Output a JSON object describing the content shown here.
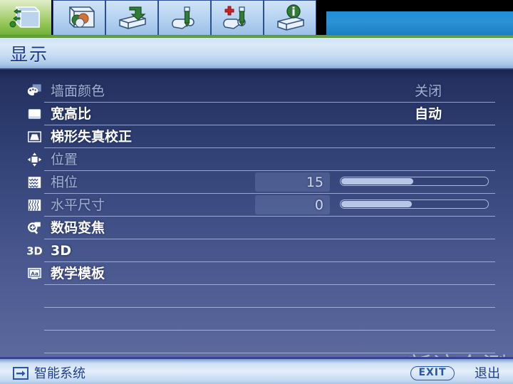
{
  "tabs": [
    {
      "name": "display",
      "icon": "display-screen-gear-icon",
      "active": true
    },
    {
      "name": "picture",
      "icon": "picture-color-icon",
      "active": false
    },
    {
      "name": "source",
      "icon": "projector-input-icon",
      "active": false
    },
    {
      "name": "system",
      "icon": "wrench-screwdriver-icon",
      "active": false
    },
    {
      "name": "advanced",
      "icon": "wrench-plus-icon",
      "active": false
    },
    {
      "name": "info",
      "icon": "projector-info-icon",
      "active": false
    }
  ],
  "title": "显示",
  "menu": {
    "rows": [
      {
        "icon": "palette-icon",
        "label": "墙面颜色",
        "value": "关闭",
        "enabled": false,
        "type": "value"
      },
      {
        "icon": "aspect-screen-icon",
        "label": "宽高比",
        "value": "自动",
        "enabled": true,
        "type": "value"
      },
      {
        "icon": "keystone-icon",
        "label": "梯形失真校正",
        "value": "",
        "enabled": true,
        "type": "submenu"
      },
      {
        "icon": "position-arrows-icon",
        "label": "位置",
        "value": "",
        "enabled": false,
        "type": "submenu"
      },
      {
        "icon": "phase-wave-icon",
        "label": "相位",
        "value": "15",
        "enabled": false,
        "type": "slider",
        "percent": 49
      },
      {
        "icon": "hsize-wave-icon",
        "label": "水平尺寸",
        "value": "0",
        "enabled": false,
        "type": "slider",
        "percent": 48
      },
      {
        "icon": "digital-zoom-icon",
        "label": "数码变焦",
        "value": "",
        "enabled": true,
        "type": "submenu"
      },
      {
        "icon": "three-d-icon",
        "label": "3D",
        "value": "",
        "enabled": true,
        "type": "submenu"
      },
      {
        "icon": "teaching-template-icon",
        "label": "教学模板",
        "value": "",
        "enabled": true,
        "type": "submenu"
      },
      {
        "icon": "",
        "label": "",
        "value": "",
        "enabled": true,
        "type": "empty"
      },
      {
        "icon": "",
        "label": "",
        "value": "",
        "enabled": true,
        "type": "empty"
      },
      {
        "icon": "",
        "label": "",
        "value": "",
        "enabled": true,
        "type": "empty"
      }
    ]
  },
  "bottom": {
    "enter_label": "智能系统",
    "exit_button": "EXIT",
    "exit_label": "退出"
  },
  "watermark": {
    "text": "新浪众测"
  },
  "colors": {
    "accent_green": "#6fae4a",
    "accent_blue": "#2c92d6",
    "panel_top": "#232f5e",
    "panel_bottom": "#5c699d",
    "text_on": "#ffffff",
    "text_off": "#9fb0cf",
    "title_text": "#1b3a86"
  }
}
